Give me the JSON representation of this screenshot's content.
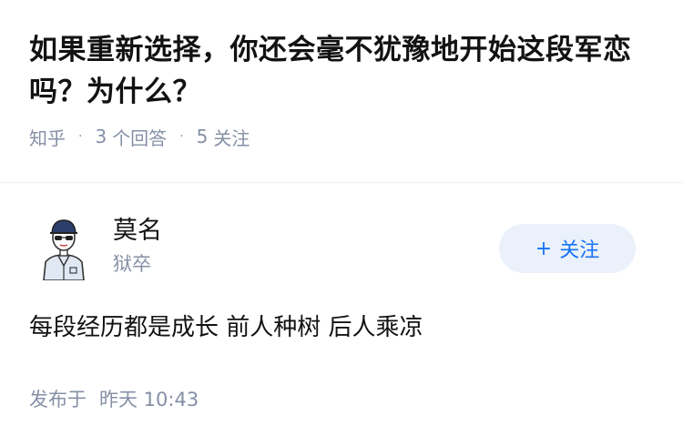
{
  "question": {
    "title": "如果重新选择，你还会毫不犹豫地开始这段军恋吗？为什么？",
    "source": "知乎",
    "answer_count": "3",
    "answer_label": "个回答",
    "follow_count": "5",
    "follow_label": "关注"
  },
  "author": {
    "name": "莫名",
    "headline": "狱卒",
    "avatar_icon": "cartoon-avatar-icon",
    "follow_button_label": "关注",
    "follow_button_icon": "plus-icon"
  },
  "answer": {
    "content": "每段经历都是成长 前人种树 后人乘凉",
    "published_label": "发布于",
    "published_time": "昨天 10:43"
  },
  "colors": {
    "accent": "#1772f6",
    "button_bg": "#eaf1fb",
    "muted_text": "#8590a6",
    "text": "#121212"
  }
}
